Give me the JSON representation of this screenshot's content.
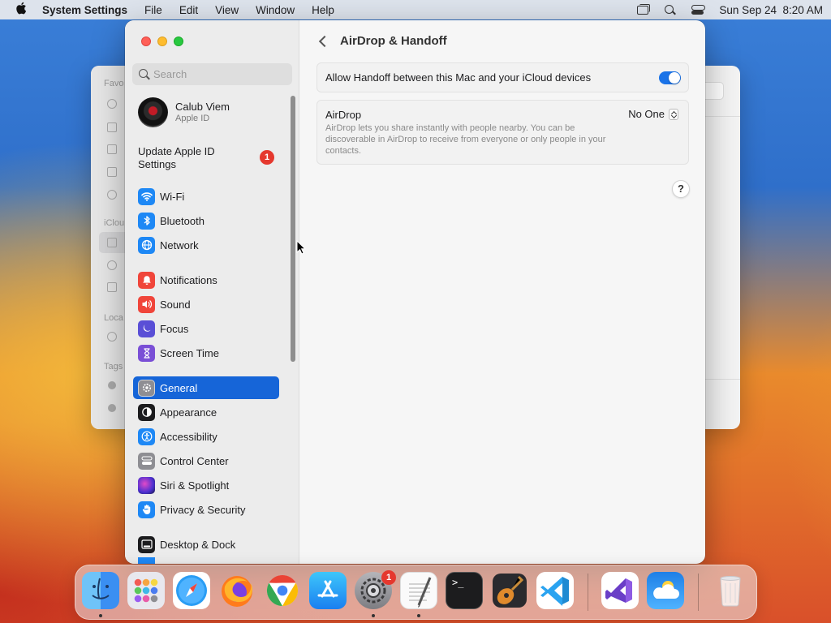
{
  "menubar": {
    "app_name": "System Settings",
    "menus": [
      "File",
      "Edit",
      "View",
      "Window",
      "Help"
    ],
    "clock": "Sun Sep 24  8:20 AM"
  },
  "sidebar": {
    "search_placeholder": "Search",
    "profile": {
      "name": "Calub Viem",
      "subtitle": "Apple ID"
    },
    "update": {
      "line1": "Update Apple ID",
      "line2": "Settings",
      "badge": "1"
    },
    "items": [
      {
        "label": "Wi-Fi",
        "icon": "wifi-icon",
        "color": "#1e88f5"
      },
      {
        "label": "Bluetooth",
        "icon": "bluetooth-icon",
        "color": "#1e88f5"
      },
      {
        "label": "Network",
        "icon": "globe-icon",
        "color": "#1e88f5"
      },
      {
        "label": "Notifications",
        "icon": "bell-icon",
        "color": "#f0453a"
      },
      {
        "label": "Sound",
        "icon": "speaker-icon",
        "color": "#f0453a"
      },
      {
        "label": "Focus",
        "icon": "moon-icon",
        "color": "#5a4fd6"
      },
      {
        "label": "Screen Time",
        "icon": "hourglass-icon",
        "color": "#7a4fd6"
      },
      {
        "label": "General",
        "icon": "gear-icon",
        "color": "#8e8e93"
      },
      {
        "label": "Appearance",
        "icon": "appearance-icon",
        "color": "#1c1c1e"
      },
      {
        "label": "Accessibility",
        "icon": "accessibility-icon",
        "color": "#1e88f5"
      },
      {
        "label": "Control Center",
        "icon": "toggles-icon",
        "color": "#8e8e93"
      },
      {
        "label": "Siri & Spotlight",
        "icon": "siri-icon",
        "color": "#6a3fd0"
      },
      {
        "label": "Privacy & Security",
        "icon": "hand-icon",
        "color": "#1e88f5"
      },
      {
        "label": "Desktop & Dock",
        "icon": "dock-icon",
        "color": "#1c1c1e"
      }
    ],
    "selected": "General"
  },
  "content": {
    "title": "AirDrop & Handoff",
    "handoff_label": "Allow Handoff between this Mac and your iCloud devices",
    "handoff_enabled": true,
    "airdrop_label": "AirDrop",
    "airdrop_description": "AirDrop lets you share instantly with people nearby. You can be discoverable in AirDrop to receive from everyone or only people in your contacts.",
    "airdrop_value": "No One",
    "help_label": "?"
  },
  "finder_bg": {
    "labels": [
      "Favo",
      "iClou",
      "Loca",
      "Tags"
    ]
  },
  "dock": {
    "apps": [
      {
        "name": "Finder",
        "icon": "finder-icon",
        "running": true
      },
      {
        "name": "Launchpad",
        "icon": "launchpad-icon",
        "running": false
      },
      {
        "name": "Safari",
        "icon": "safari-icon",
        "running": false
      },
      {
        "name": "Firefox",
        "icon": "firefox-icon",
        "running": false
      },
      {
        "name": "Chrome",
        "icon": "chrome-icon",
        "running": false
      },
      {
        "name": "App Store",
        "icon": "app-store-icon",
        "running": false
      },
      {
        "name": "System Settings",
        "icon": "system-settings-icon",
        "running": true,
        "badge": "1"
      },
      {
        "name": "TextEdit",
        "icon": "textedit-icon",
        "running": true
      },
      {
        "name": "Terminal",
        "icon": "terminal-icon",
        "running": false
      },
      {
        "name": "GarageBand",
        "icon": "garageband-icon",
        "running": false
      },
      {
        "name": "Visual Studio Code",
        "icon": "vscode-icon",
        "running": false
      },
      {
        "name": "Visual Studio",
        "icon": "visual-studio-icon",
        "running": false
      },
      {
        "name": "Weather",
        "icon": "weather-icon",
        "running": false
      },
      {
        "name": "Trash",
        "icon": "trash-icon",
        "running": false
      }
    ],
    "terminal_prompt": ">_"
  }
}
